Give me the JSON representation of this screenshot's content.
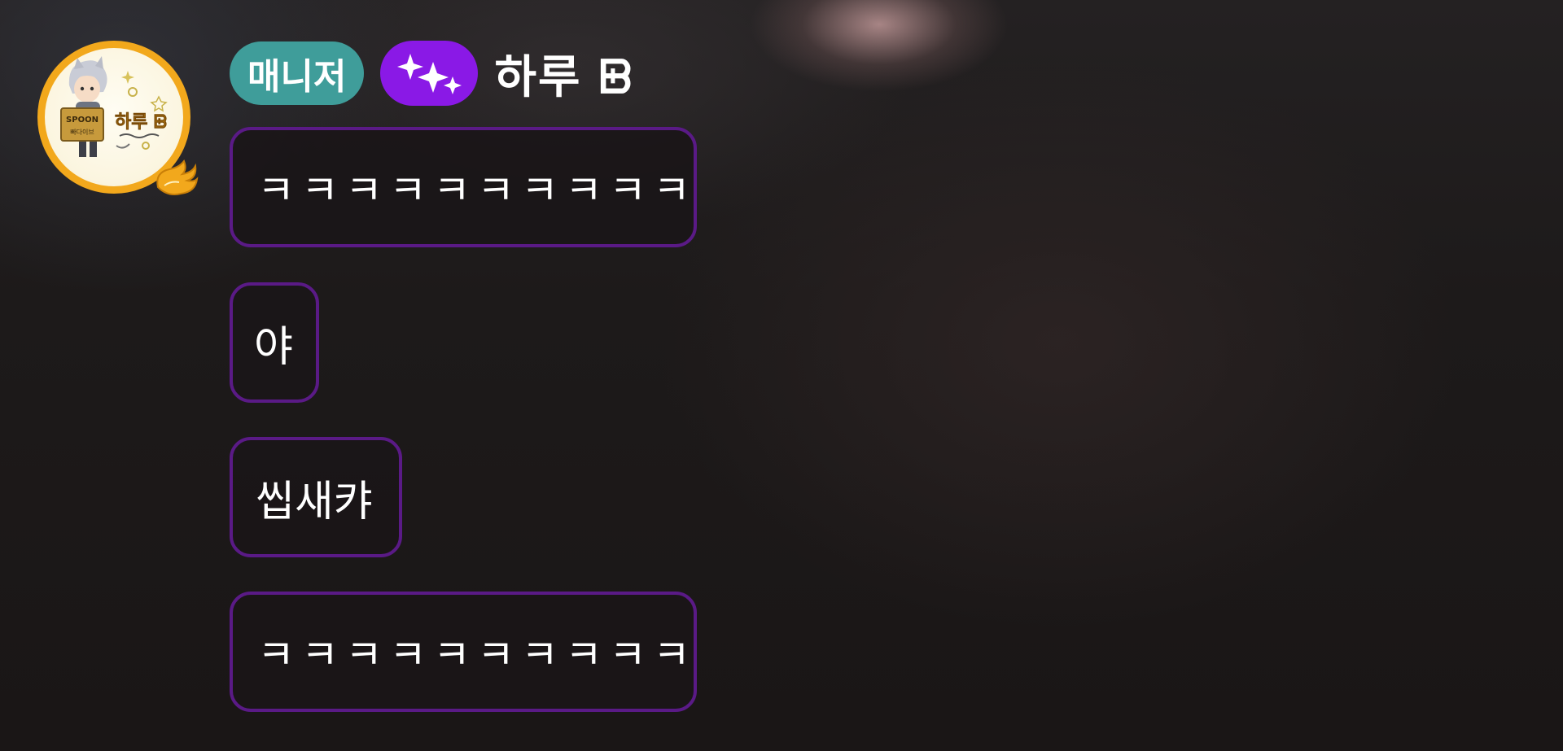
{
  "sender": {
    "role_badge": "매니저",
    "sparkle_badge_icon": "sparkles-icon",
    "name": "하루 ᗸ",
    "avatar": {
      "icon": "profile-avatar",
      "sign_text": "SPOON",
      "sign_subtext": "빠다이브",
      "name_text": "하루 ᗸ",
      "ring_color": "#f2a81c",
      "frame_icon": "golden-wing-icon"
    }
  },
  "messages": [
    {
      "text": "ㅋㅋㅋㅋㅋㅋㅋㅋㅋㅋ"
    },
    {
      "text": "야"
    },
    {
      "text": "씹새캬"
    },
    {
      "text": "ㅋㅋㅋㅋㅋㅋㅋㅋㅋㅋ"
    }
  ],
  "colors": {
    "manager_badge": "#3f9d9a",
    "sparkle_badge": "#8a19e6",
    "bubble_border": "#5a1a86",
    "text": "#ffffff"
  }
}
